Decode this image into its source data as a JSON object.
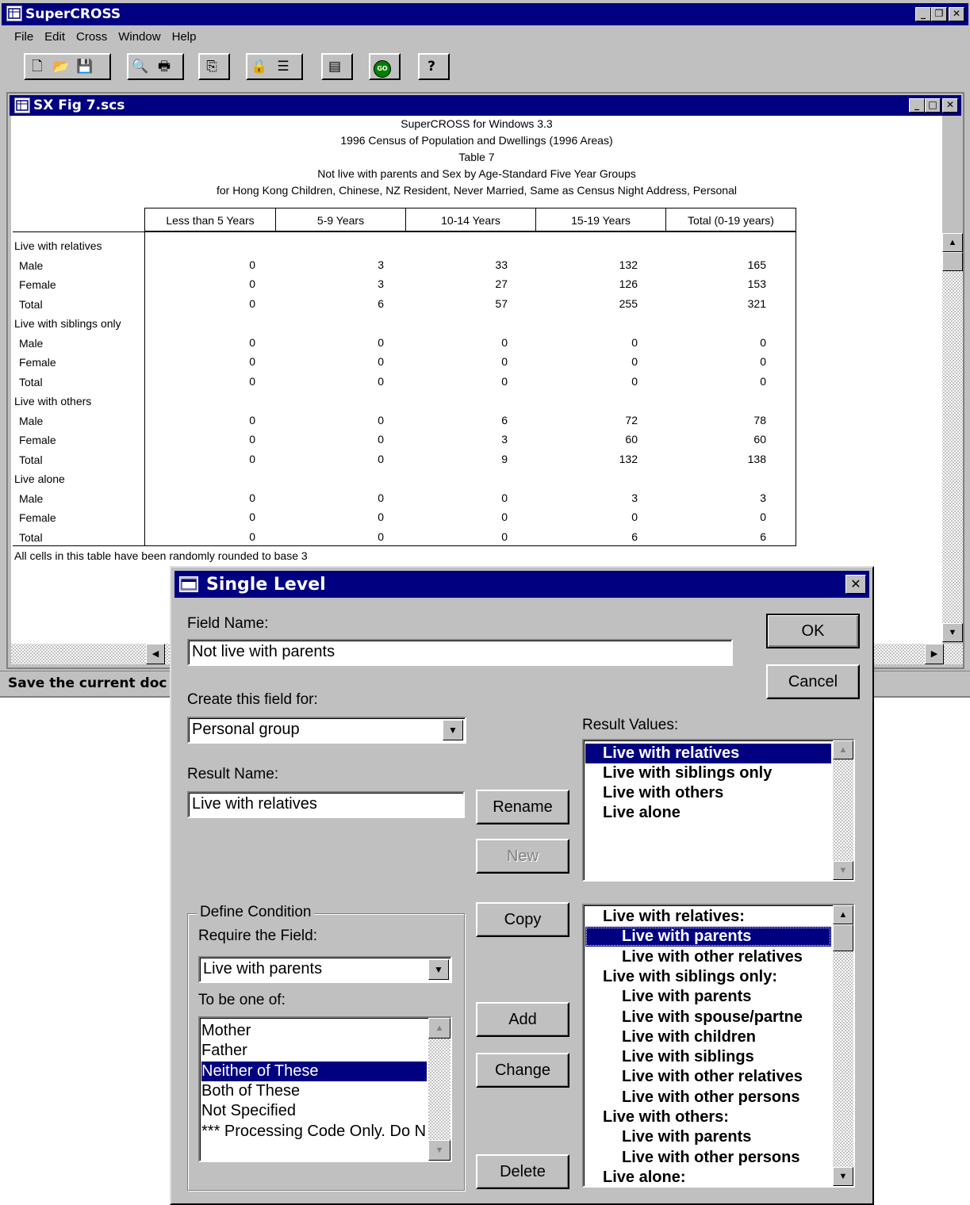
{
  "app": {
    "title": "SuperCROSS",
    "menu": [
      "File",
      "Edit",
      "Cross",
      "Window",
      "Help"
    ],
    "toolbar_icons": [
      "new-icon",
      "open-icon",
      "save-icon",
      "print-preview-icon",
      "print-icon",
      "copy-icon",
      "lock-icon",
      "layout-icon",
      "field-icon",
      "go-icon",
      "help-icon"
    ],
    "status": "Save the current doc"
  },
  "doc": {
    "title": "SX Fig 7.scs",
    "header_lines": [
      "SuperCROSS for Windows 3.3",
      "1996 Census of Population and Dwellings (1996 Areas)",
      "Table 7",
      "Not live with parents and Sex by Age-Standard Five Year Groups",
      "for Hong Kong Children, Chinese, NZ Resident, Never Married, Same as Census Night Address, Personal"
    ],
    "columns": [
      "Less than 5 Years",
      "5-9 Years",
      "10-14 Years",
      "15-19 Years",
      "Total (0-19 years)"
    ],
    "groups": [
      {
        "label": "Live with relatives",
        "rows": [
          {
            "label": "Male",
            "values": [
              "0",
              "3",
              "33",
              "132",
              "165"
            ]
          },
          {
            "label": "Female",
            "values": [
              "0",
              "3",
              "27",
              "126",
              "153"
            ]
          },
          {
            "label": "Total",
            "values": [
              "0",
              "6",
              "57",
              "255",
              "321"
            ]
          }
        ]
      },
      {
        "label": "Live with siblings only",
        "rows": [
          {
            "label": "Male",
            "values": [
              "0",
              "0",
              "0",
              "0",
              "0"
            ]
          },
          {
            "label": "Female",
            "values": [
              "0",
              "0",
              "0",
              "0",
              "0"
            ]
          },
          {
            "label": "Total",
            "values": [
              "0",
              "0",
              "0",
              "0",
              "0"
            ]
          }
        ]
      },
      {
        "label": "Live with others",
        "rows": [
          {
            "label": "Male",
            "values": [
              "0",
              "0",
              "6",
              "72",
              "78"
            ]
          },
          {
            "label": "Female",
            "values": [
              "0",
              "0",
              "3",
              "60",
              "60"
            ]
          },
          {
            "label": "Total",
            "values": [
              "0",
              "0",
              "9",
              "132",
              "138"
            ]
          }
        ]
      },
      {
        "label": "Live alone",
        "rows": [
          {
            "label": "Male",
            "values": [
              "0",
              "0",
              "0",
              "3",
              "3"
            ]
          },
          {
            "label": "Female",
            "values": [
              "0",
              "0",
              "0",
              "0",
              "0"
            ]
          },
          {
            "label": "Total",
            "values": [
              "0",
              "0",
              "0",
              "6",
              "6"
            ]
          }
        ]
      }
    ],
    "footnote": "All cells in this table have been randomly rounded to base 3"
  },
  "dialog": {
    "title": "Single Level",
    "field_name_label": "Field Name:",
    "field_name_value": "Not live with parents",
    "create_for_label": "Create this field for:",
    "create_for_value": "Personal group",
    "result_name_label": "Result Name:",
    "result_name_value": "Live with relatives",
    "result_values_label": "Result Values:",
    "result_values": [
      "Live with relatives",
      "Live with siblings only",
      "Live with others",
      "Live alone"
    ],
    "selected_result": "Live with relatives",
    "buttons": {
      "ok": "OK",
      "cancel": "Cancel",
      "rename": "Rename",
      "new": "New",
      "copy": "Copy",
      "add": "Add",
      "change": "Change",
      "delete": "Delete"
    },
    "define_condition_label": "Define Condition",
    "require_field_label": "Require the Field:",
    "require_field_value": "Live with parents",
    "to_be_one_of_label": "To be one of:",
    "options": [
      "Mother",
      "Father",
      "Neither of These",
      "Both of These",
      "Not Specified",
      "*** Processing Code Only. Do N"
    ],
    "selected_option": "Neither of These",
    "conditions": [
      {
        "text": "Live with relatives:",
        "indent": 0,
        "selected": false
      },
      {
        "text": "Live with parents",
        "indent": 1,
        "selected": true
      },
      {
        "text": "Live with other relatives",
        "indent": 1,
        "selected": false
      },
      {
        "text": "Live with siblings only:",
        "indent": 0,
        "selected": false
      },
      {
        "text": "Live with parents",
        "indent": 1,
        "selected": false
      },
      {
        "text": "Live with spouse/partne",
        "indent": 1,
        "selected": false
      },
      {
        "text": "Live with children",
        "indent": 1,
        "selected": false
      },
      {
        "text": "Live with siblings",
        "indent": 1,
        "selected": false
      },
      {
        "text": "Live with other relatives",
        "indent": 1,
        "selected": false
      },
      {
        "text": "Live with other persons",
        "indent": 1,
        "selected": false
      },
      {
        "text": "Live with others:",
        "indent": 0,
        "selected": false
      },
      {
        "text": "Live with parents",
        "indent": 1,
        "selected": false
      },
      {
        "text": "Live with other persons",
        "indent": 1,
        "selected": false
      },
      {
        "text": "Live alone:",
        "indent": 0,
        "selected": false
      }
    ]
  }
}
